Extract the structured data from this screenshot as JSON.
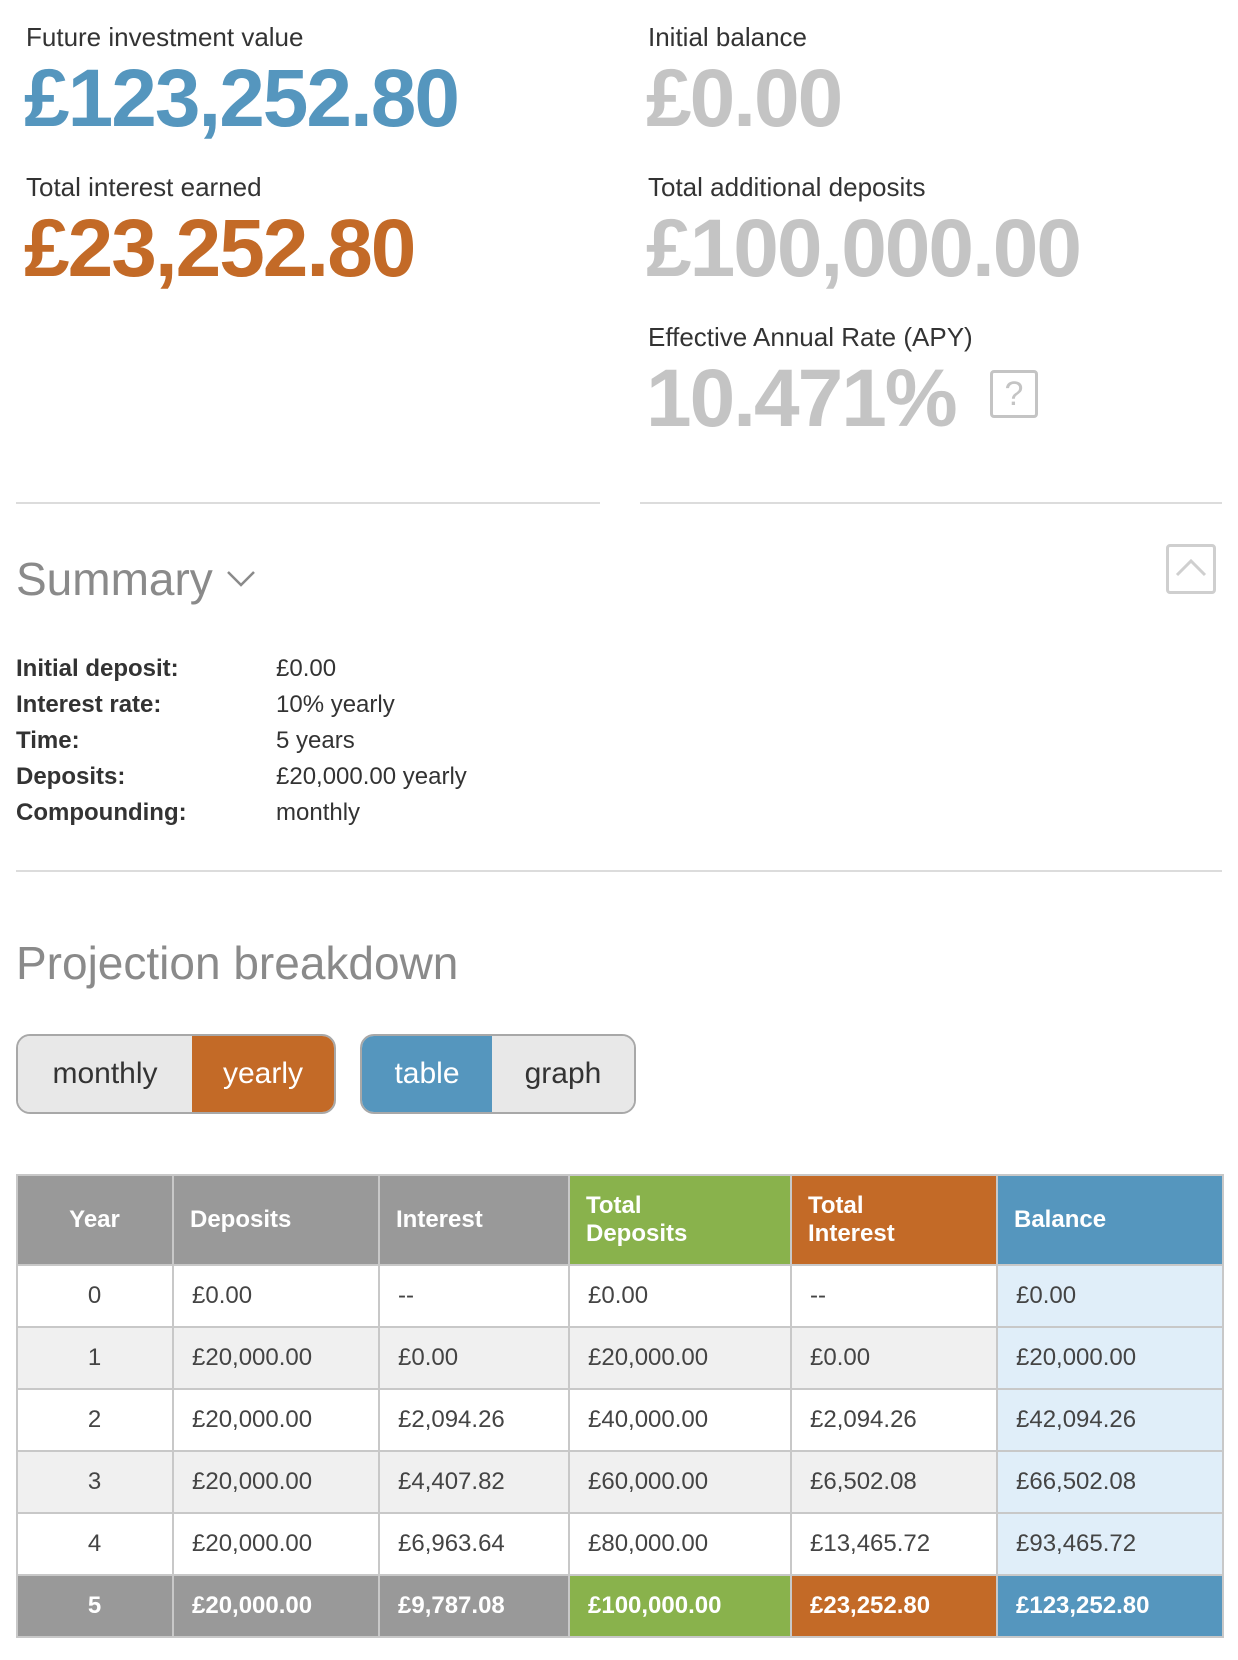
{
  "colors": {
    "accent_blue": "#5596be",
    "accent_orange": "#c36a27",
    "accent_green": "#89b24c",
    "muted_gray": "#c4c4c4",
    "header_gray": "#999999",
    "balance_bg": "#e0eef9"
  },
  "stats": {
    "future_value": {
      "label": "Future investment value",
      "value": "£123,252.80"
    },
    "initial_balance": {
      "label": "Initial balance",
      "value": "£0.00"
    },
    "total_interest": {
      "label": "Total interest earned",
      "value": "£23,252.80"
    },
    "additional_deposits": {
      "label": "Total additional deposits",
      "value": "£100,000.00"
    },
    "apy": {
      "label": "Effective Annual Rate (APY)",
      "value": "10.471%",
      "help": "?"
    }
  },
  "summary": {
    "title": "Summary",
    "rows": [
      {
        "label": "Initial deposit:",
        "value": "£0.00"
      },
      {
        "label": "Interest rate:",
        "value": "10% yearly"
      },
      {
        "label": "Time:",
        "value": "5 years"
      },
      {
        "label": "Deposits:",
        "value": "£20,000.00 yearly"
      },
      {
        "label": "Compounding:",
        "value": "monthly"
      }
    ]
  },
  "projection": {
    "title": "Projection breakdown",
    "period_toggle": {
      "monthly": "monthly",
      "yearly": "yearly",
      "selected": "yearly"
    },
    "view_toggle": {
      "table": "table",
      "graph": "graph",
      "selected": "table"
    },
    "columns": [
      "Year",
      "Deposits",
      "Interest",
      "Total Deposits",
      "Total Interest",
      "Balance"
    ],
    "rows": [
      [
        "0",
        "£0.00",
        "--",
        "£0.00",
        "--",
        "£0.00"
      ],
      [
        "1",
        "£20,000.00",
        "£0.00",
        "£20,000.00",
        "£0.00",
        "£20,000.00"
      ],
      [
        "2",
        "£20,000.00",
        "£2,094.26",
        "£40,000.00",
        "£2,094.26",
        "£42,094.26"
      ],
      [
        "3",
        "£20,000.00",
        "£4,407.82",
        "£60,000.00",
        "£6,502.08",
        "£66,502.08"
      ],
      [
        "4",
        "£20,000.00",
        "£6,963.64",
        "£80,000.00",
        "£13,465.72",
        "£93,465.72"
      ],
      [
        "5",
        "£20,000.00",
        "£9,787.08",
        "£100,000.00",
        "£23,252.80",
        "£123,252.80"
      ]
    ]
  }
}
